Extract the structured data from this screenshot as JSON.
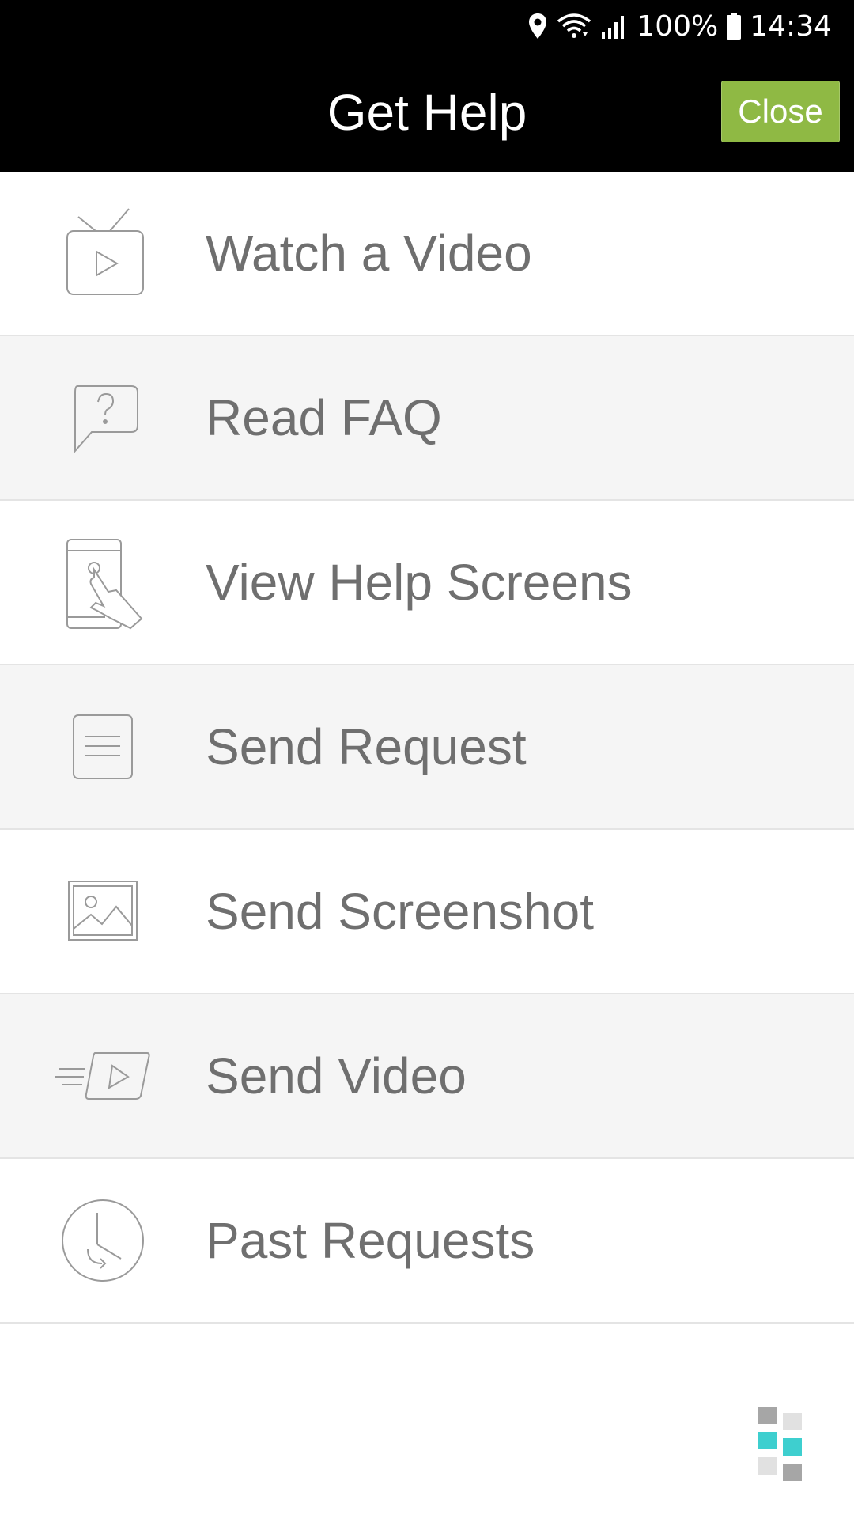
{
  "status_bar": {
    "battery": "100%",
    "time": "14:34"
  },
  "header": {
    "title": "Get Help",
    "close_label": "Close"
  },
  "menu": {
    "items": [
      {
        "label": "Watch a Video",
        "icon": "tv-play-icon"
      },
      {
        "label": "Read FAQ",
        "icon": "question-bubble-icon"
      },
      {
        "label": "View Help Screens",
        "icon": "phone-touch-icon"
      },
      {
        "label": "Send Request",
        "icon": "document-icon"
      },
      {
        "label": "Send Screenshot",
        "icon": "image-icon"
      },
      {
        "label": "Send Video",
        "icon": "video-send-icon"
      },
      {
        "label": "Past Requests",
        "icon": "clock-history-icon"
      }
    ]
  },
  "colors": {
    "header_bg": "#000000",
    "close_button": "#8fb944",
    "label_text": "#6f6f6f",
    "alt_row_bg": "#f5f5f5",
    "brand_teal": "#3ecfcf"
  }
}
